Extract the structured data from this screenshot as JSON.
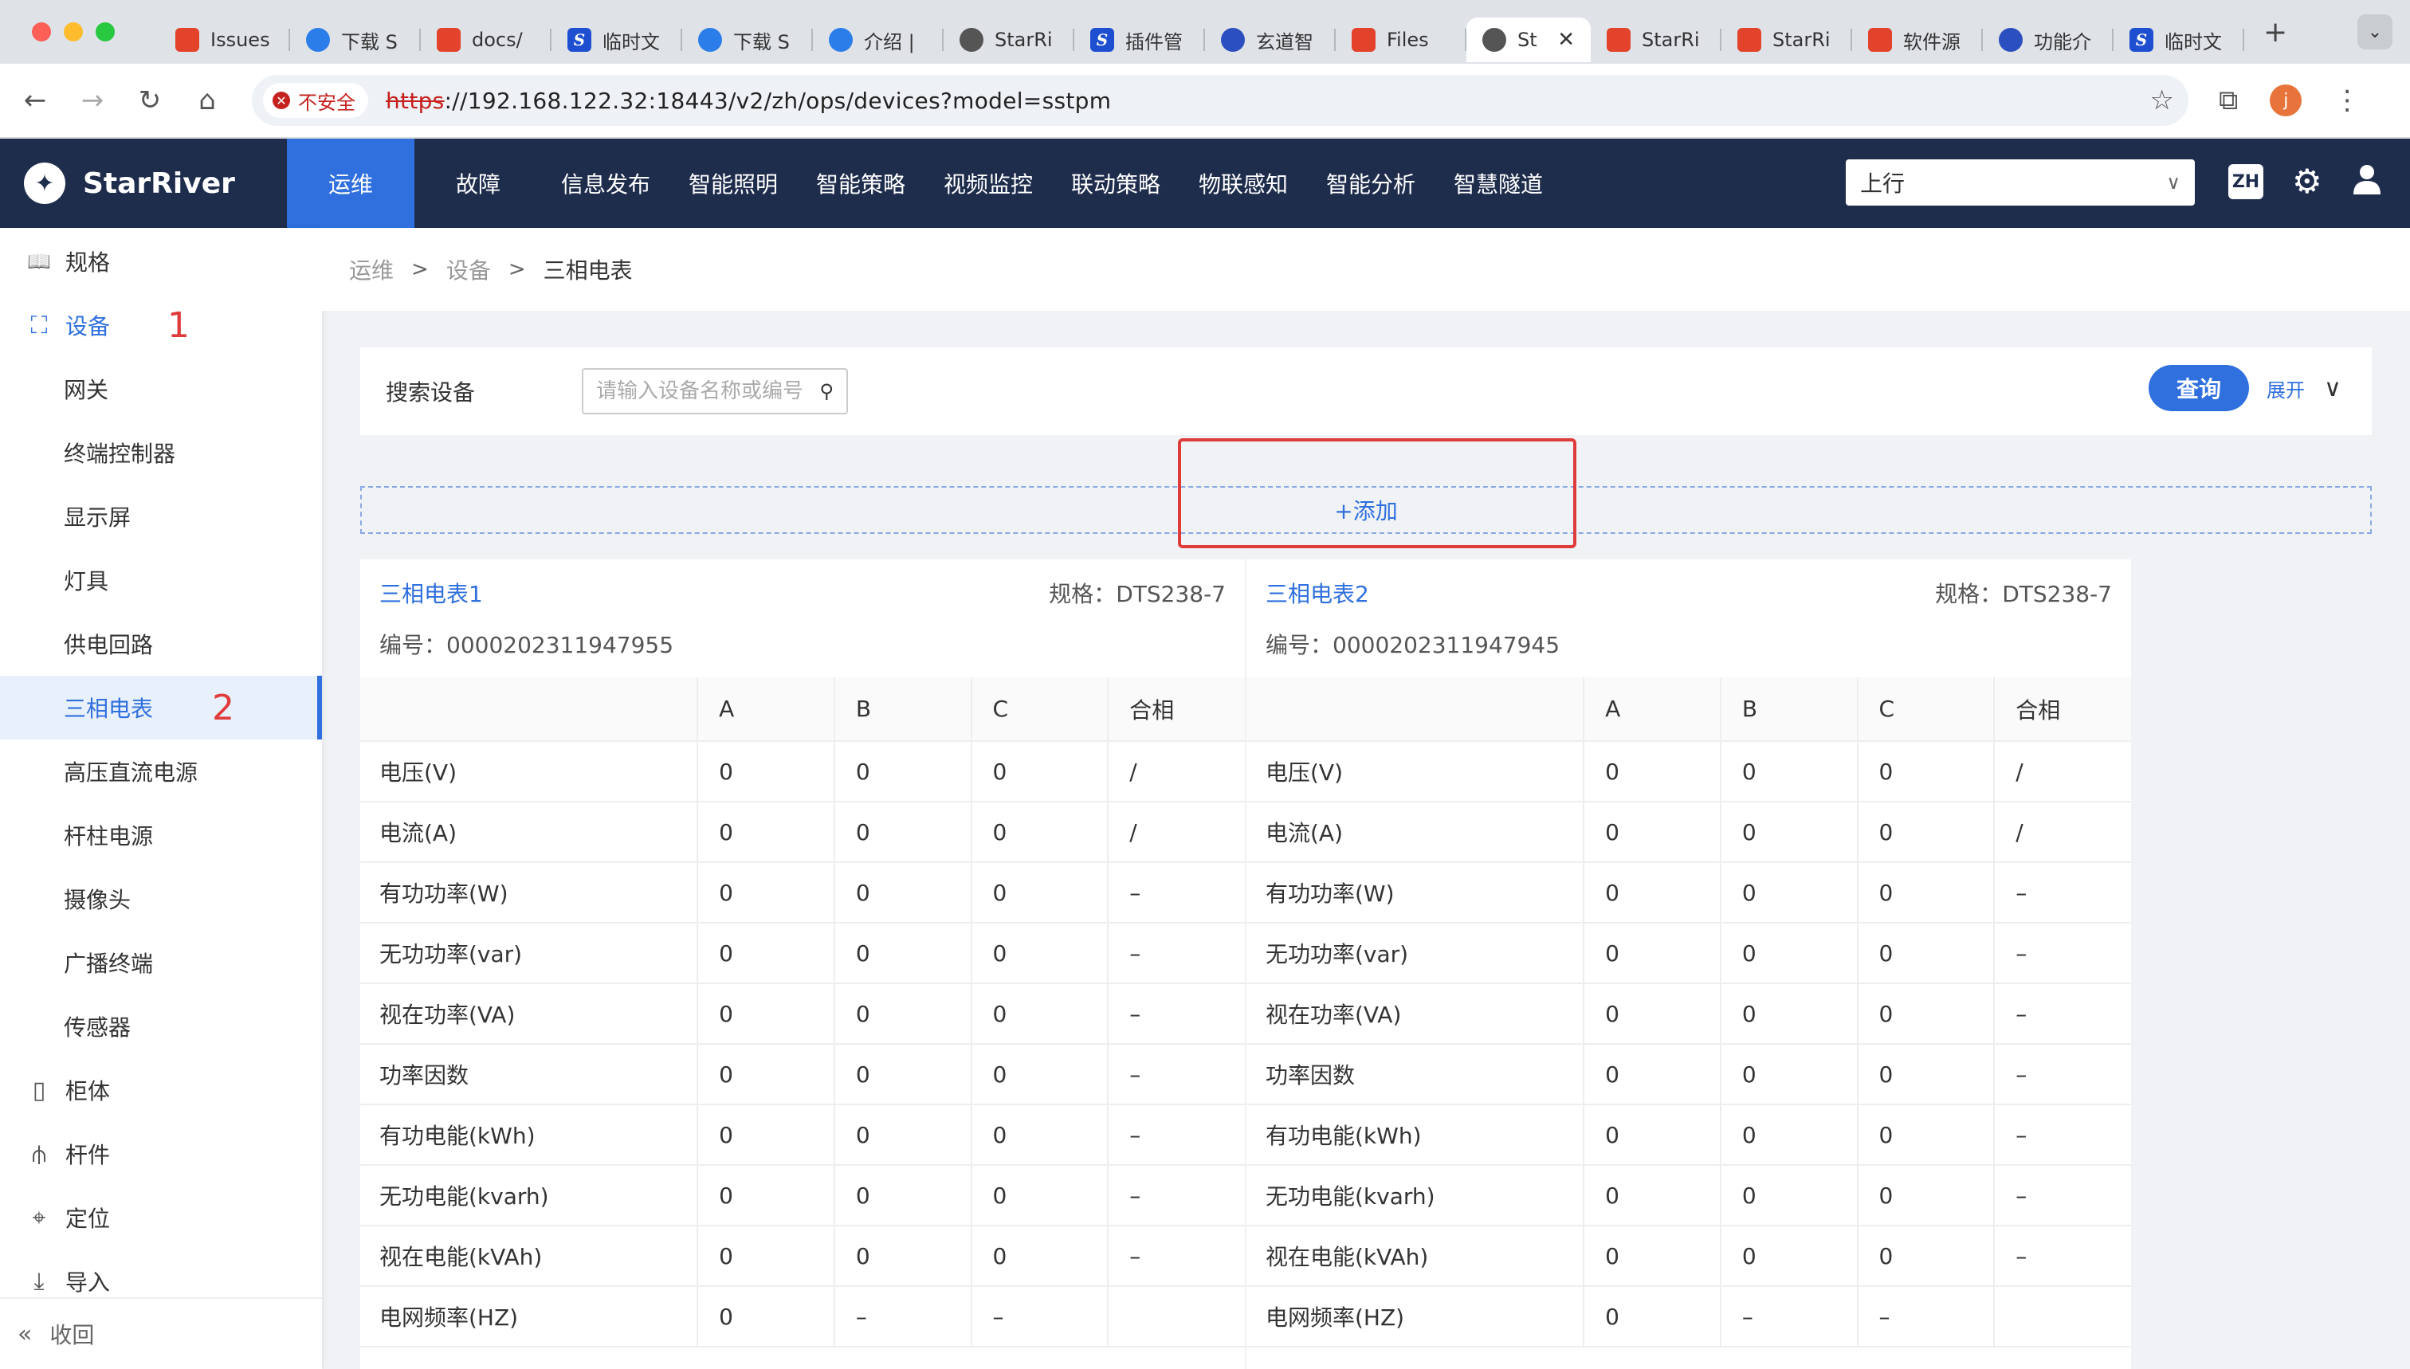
{
  "browser": {
    "tabs": [
      {
        "label": "Issues",
        "icon": "gitlab-icon",
        "color": "#e2432a"
      },
      {
        "label": "下载 S",
        "icon": "vscode-icon",
        "color": "#2b7de9"
      },
      {
        "label": "docs/",
        "icon": "gitlab-icon",
        "color": "#e2432a"
      },
      {
        "label": "临时文",
        "icon": "s-app-icon",
        "color": "#1f4fd1"
      },
      {
        "label": "下载 S",
        "icon": "vscode-icon",
        "color": "#2b7de9"
      },
      {
        "label": "介绍 |",
        "icon": "vscode-icon",
        "color": "#2b7de9"
      },
      {
        "label": "StarRi",
        "icon": "globe-icon",
        "color": "#555555"
      },
      {
        "label": "插件管",
        "icon": "s-app-icon",
        "color": "#1f4fd1"
      },
      {
        "label": "玄道智",
        "icon": "app-icon",
        "color": "#2b4fbf"
      },
      {
        "label": "Files",
        "icon": "gitlab-icon",
        "color": "#e2432a"
      },
      {
        "label": "St",
        "icon": "globe-icon",
        "color": "#555555",
        "active": true
      },
      {
        "label": "StarRi",
        "icon": "gitlab-icon",
        "color": "#e2432a"
      },
      {
        "label": "StarRi",
        "icon": "gitlab-icon",
        "color": "#e2432a"
      },
      {
        "label": "软件源",
        "icon": "gitlab-icon",
        "color": "#e2432a"
      },
      {
        "label": "功能介",
        "icon": "app-icon",
        "color": "#2b4fbf"
      },
      {
        "label": "临时文",
        "icon": "s-app-icon",
        "color": "#1f4fd1"
      }
    ],
    "insecure_label": "不安全",
    "url_proto": "https",
    "url_rest": "://192.168.122.32:18443/v2/zh/ops/devices?model=sstpm",
    "profile_initial": "j"
  },
  "header": {
    "brand": "StarRiver",
    "nav": [
      "运维",
      "故障",
      "信息发布",
      "智能照明",
      "智能策略",
      "视频监控",
      "联动策略",
      "物联感知",
      "智能分析",
      "智慧隧道"
    ],
    "active_nav": 0,
    "direction_select": "上行",
    "lang": "ZH"
  },
  "sidebar": {
    "items": [
      {
        "label": "规格",
        "icon": "book-icon",
        "level": 0
      },
      {
        "label": "设备",
        "icon": "router-icon",
        "level": 0,
        "blue": true,
        "marker": "1"
      },
      {
        "label": "网关",
        "level": 1
      },
      {
        "label": "终端控制器",
        "level": 1
      },
      {
        "label": "显示屏",
        "level": 1
      },
      {
        "label": "灯具",
        "level": 1
      },
      {
        "label": "供电回路",
        "level": 1
      },
      {
        "label": "三相电表",
        "level": 1,
        "selected": true,
        "marker": "2"
      },
      {
        "label": "高压直流电源",
        "level": 1
      },
      {
        "label": "杆柱电源",
        "level": 1
      },
      {
        "label": "摄像头",
        "level": 1
      },
      {
        "label": "广播终端",
        "level": 1
      },
      {
        "label": "传感器",
        "level": 1
      },
      {
        "label": "柜体",
        "icon": "cabinet-icon",
        "level": 0
      },
      {
        "label": "杆件",
        "icon": "pole-icon",
        "level": 0
      },
      {
        "label": "定位",
        "icon": "location-icon",
        "level": 0
      },
      {
        "label": "导入",
        "icon": "import-icon",
        "level": 0
      }
    ],
    "collapse_label": "收回"
  },
  "breadcrumb": [
    "运维",
    "设备",
    "三相电表"
  ],
  "search": {
    "label": "搜索设备",
    "placeholder": "请输入设备名称或编号",
    "query_label": "查询",
    "expand_label": "展开"
  },
  "add_label": "+添加",
  "card_labels": {
    "spec_prefix": "规格：",
    "code_prefix": "编号："
  },
  "table_headers": [
    "",
    "A",
    "B",
    "C",
    "合相"
  ],
  "meters": [
    {
      "name": "三相电表1",
      "spec": "DTS238-7",
      "code": "0000202311947955",
      "rows": [
        [
          "电压(V)",
          "0",
          "0",
          "0",
          "/"
        ],
        [
          "电流(A)",
          "0",
          "0",
          "0",
          "/"
        ],
        [
          "有功功率(W)",
          "0",
          "0",
          "0",
          "–"
        ],
        [
          "无功功率(var)",
          "0",
          "0",
          "0",
          "–"
        ],
        [
          "视在功率(VA)",
          "0",
          "0",
          "0",
          "–"
        ],
        [
          "功率因数",
          "0",
          "0",
          "0",
          "–"
        ],
        [
          "有功电能(kWh)",
          "0",
          "0",
          "0",
          "–"
        ],
        [
          "无功电能(kvarh)",
          "0",
          "0",
          "0",
          "–"
        ],
        [
          "视在电能(kVAh)",
          "0",
          "0",
          "0",
          "–"
        ],
        [
          "电网频率(HZ)",
          "0",
          "–",
          "–",
          ""
        ]
      ]
    },
    {
      "name": "三相电表2",
      "spec": "DTS238-7",
      "code": "0000202311947945",
      "rows": [
        [
          "电压(V)",
          "0",
          "0",
          "0",
          "/"
        ],
        [
          "电流(A)",
          "0",
          "0",
          "0",
          "/"
        ],
        [
          "有功功率(W)",
          "0",
          "0",
          "0",
          "–"
        ],
        [
          "无功功率(var)",
          "0",
          "0",
          "0",
          "–"
        ],
        [
          "视在功率(VA)",
          "0",
          "0",
          "0",
          "–"
        ],
        [
          "功率因数",
          "0",
          "0",
          "0",
          "–"
        ],
        [
          "有功电能(kWh)",
          "0",
          "0",
          "0",
          "–"
        ],
        [
          "无功电能(kvarh)",
          "0",
          "0",
          "0",
          "–"
        ],
        [
          "视在电能(kVAh)",
          "0",
          "0",
          "0",
          "–"
        ],
        [
          "电网频率(HZ)",
          "0",
          "–",
          "–",
          ""
        ]
      ]
    }
  ],
  "colors": {
    "primary": "#2f6fde",
    "header_bg": "#1f2d4d",
    "annotation_red": "#e03b3b"
  }
}
